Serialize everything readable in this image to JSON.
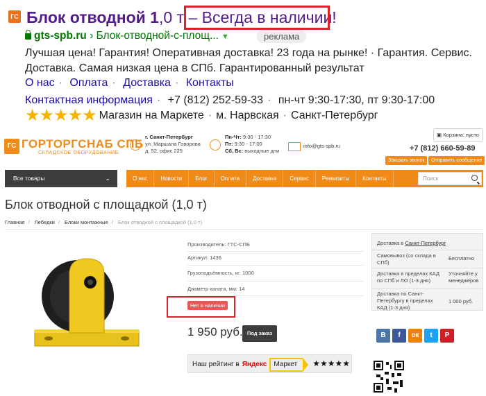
{
  "ad": {
    "favicon": "ГС",
    "title_main": "Блок отводной 1",
    "title_rest": ",0 т – ",
    "title_hl": "Всегда в наличии!",
    "url_domain": "gts-spb.ru",
    "url_path": "› Блок-отводной-с-площ...",
    "badge": "реклама",
    "description": "Лучшая цена! Гарантия! Оперативная доставка! 23 года на рынке! · Гарантия. Сервис. Доставка. Самая низкая цена в СПб. Гарантированный результат",
    "sitelinks": [
      "О нас",
      "Оплата",
      "Доставка",
      "Контакты"
    ],
    "contact_link": "Контактная информация",
    "phone": "+7 (812) 252-59-33",
    "hours": "пн-чт 9:30-17:30, пт 9:30-17:00",
    "market_label": "Магазин на Маркете",
    "metro": "м. Нарвская",
    "city": "Санкт-Петербург"
  },
  "site": {
    "logo_mark": "ГС",
    "logo_name": "ГОРТОРГСНАБ СПБ",
    "logo_sub": "СКЛАДСКОЕ ОБОРУДОВАНИЕ",
    "addr_city": "г. Санкт-Петербург",
    "addr_street": "ул. Маршала Говорова",
    "addr_house": "д. 52, офис 225",
    "hours_l1_day": "Пн-Чт:",
    "hours_l1": "9:30 - 17:30",
    "hours_l2_day": "Пт:",
    "hours_l2": "9:30 - 17:00",
    "hours_l3_day": "Сб, Вс:",
    "hours_l3": "выходные дни",
    "email": "info@gts-spb.ru",
    "cart": "Корзина: пусто",
    "phone": "+7 (812) 660-59-89",
    "callback_btn": "Заказать звонок",
    "message_btn": "Отправить сообщение",
    "all_goods": "Все товары",
    "nav": [
      "О нас",
      "Новости",
      "Блог",
      "Оплата",
      "Доставка",
      "Сервис",
      "Реквизиты",
      "Контакты"
    ],
    "search_placeholder": "Поиск"
  },
  "product": {
    "title": "Блок отводной с площадкой (1,0 т)",
    "breadcrumbs": [
      "Главная",
      "Лебедки",
      "Блоки монтажные",
      "Блок отводной с площадкой (1,0 т)"
    ],
    "props": [
      "Производитель: ГТС-СПБ",
      "Артикул: 1436",
      "Грузоподъёмность, кг: 1000",
      "Диаметр каната, мм: 14"
    ],
    "stock": "Нет в наличии",
    "price": "1 950 руб.",
    "order_btn": "Под заказ",
    "rating_label": "Наш рейтинг в",
    "yandex": "Яндекс",
    "market": "Маркет",
    "rating_stars": "★★★★★"
  },
  "delivery": {
    "head": "Доставка в",
    "head_city": "Санкт-Петербург",
    "rows": [
      {
        "label": "Самовывоз (со склада в СПб)",
        "value": "Бесплатно"
      },
      {
        "label": "Доставка в пределах КАД по СПб и ЛО (1-3 дня)",
        "value": "Уточняйте у менеджеров"
      },
      {
        "label": "Доставка по Санкт-Петербургу в пределах КАД (1-3 дня)",
        "value": "1 000 руб."
      }
    ]
  },
  "social": [
    "В",
    "f",
    "ок",
    "t",
    "P"
  ],
  "colors": {
    "accent": "#f08a18",
    "highlight": "#d8232a",
    "link": "#1a0dab",
    "url": "#007700",
    "star": "#f5b301"
  }
}
